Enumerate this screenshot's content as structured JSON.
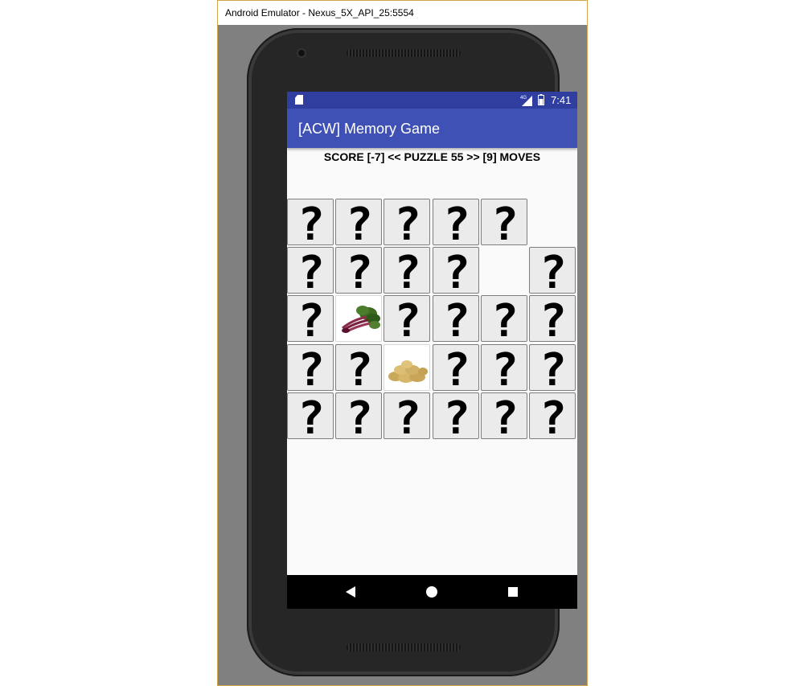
{
  "window": {
    "title": "Android Emulator - Nexus_5X_API_25:5554"
  },
  "statusbar": {
    "network_label": "4G",
    "time": "7:41",
    "icons": [
      "sd-card-icon",
      "cell-signal-icon",
      "battery-icon"
    ]
  },
  "appbar": {
    "title": "[ACW] Memory Game"
  },
  "game": {
    "score_line": "SCORE [-7] << PUZZLE 55 >> [9] MOVES",
    "columns": 6,
    "rows": 5,
    "hidden_glyph": "?",
    "tiles": [
      [
        "hidden",
        "hidden",
        "hidden",
        "hidden",
        "hidden",
        "empty"
      ],
      [
        "hidden",
        "hidden",
        "hidden",
        "hidden",
        "empty",
        "hidden"
      ],
      [
        "hidden",
        "beetroot",
        "hidden",
        "hidden",
        "hidden",
        "hidden"
      ],
      [
        "hidden",
        "hidden",
        "potatoes",
        "hidden",
        "hidden",
        "hidden"
      ],
      [
        "hidden",
        "hidden",
        "hidden",
        "hidden",
        "hidden",
        "hidden"
      ]
    ]
  },
  "navbar": {
    "buttons": [
      "back-icon",
      "home-icon",
      "recents-icon"
    ]
  },
  "colors": {
    "statusbar": "#303f9f",
    "appbar": "#3f51b5",
    "screen_bg": "#fafafa",
    "tile_bg": "#ebebeb",
    "emulator_bg": "#808080"
  }
}
